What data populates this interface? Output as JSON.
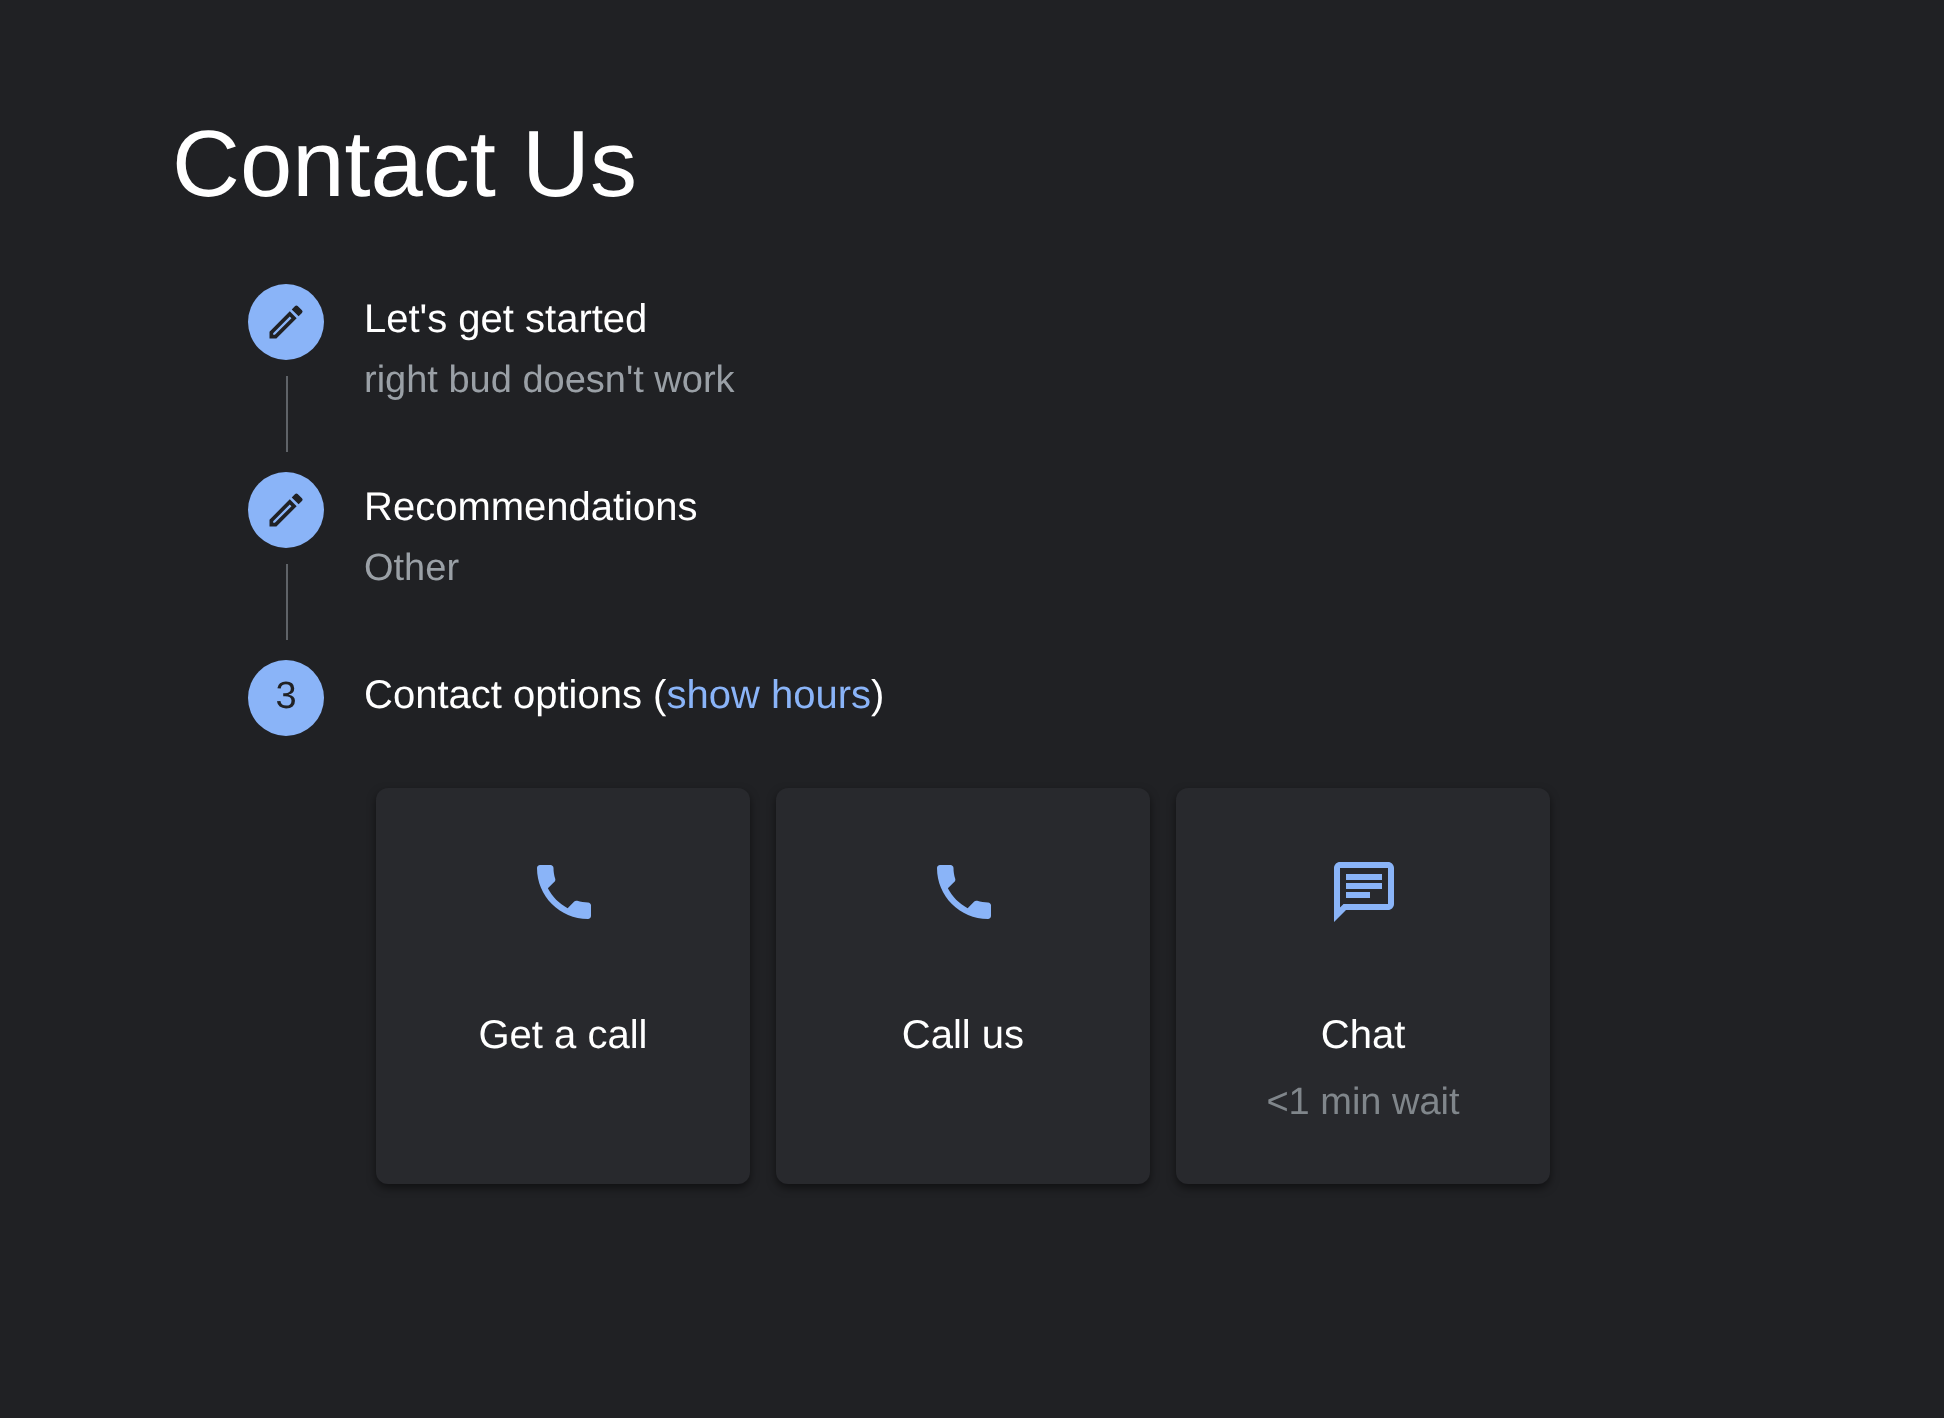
{
  "page": {
    "title": "Contact Us"
  },
  "steps": [
    {
      "kind": "done",
      "title": "Let's get started",
      "value": "right bud doesn't work"
    },
    {
      "kind": "done",
      "title": "Recommendations",
      "value": "Other"
    },
    {
      "kind": "current",
      "number": "3",
      "title": "Contact options (",
      "link": "show hours",
      "suffix": ")"
    }
  ],
  "options": [
    {
      "kind": "phone",
      "label": "Get a call"
    },
    {
      "kind": "phone",
      "label": "Call us"
    },
    {
      "kind": "chat",
      "label": "Chat",
      "note": "<1 min wait"
    }
  ]
}
